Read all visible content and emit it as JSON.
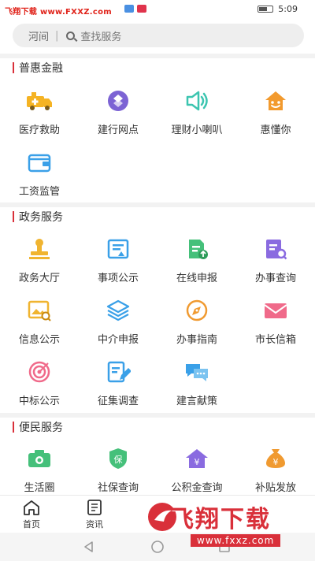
{
  "status_bar": {
    "watermark": "飞翔下载 www.FXXZ.com",
    "time": "5:09"
  },
  "search": {
    "location": "河间",
    "separator": "|",
    "placeholder": "查找服务"
  },
  "sections": [
    {
      "title": "普惠金融",
      "items": [
        {
          "label": "医疗救助",
          "icon": "ambulance-icon",
          "color": "#f5b323"
        },
        {
          "label": "建行网点",
          "icon": "bank-logo-icon",
          "color": "#7c63d4"
        },
        {
          "label": "理财小喇叭",
          "icon": "speaker-icon",
          "color": "#3cc5b0"
        },
        {
          "label": "惠懂你",
          "icon": "smiley-house-icon",
          "color": "#f29a2e"
        },
        {
          "label": "工资监管",
          "icon": "wallet-icon",
          "color": "#3aa0e8"
        }
      ]
    },
    {
      "title": "政务服务",
      "items": [
        {
          "label": "政务大厅",
          "icon": "stamp-icon",
          "color": "#f0b430"
        },
        {
          "label": "事项公示",
          "icon": "notice-board-icon",
          "color": "#3aa0e8"
        },
        {
          "label": "在线申报",
          "icon": "upload-doc-icon",
          "color": "#45c07a"
        },
        {
          "label": "办事查询",
          "icon": "doc-search-icon",
          "color": "#8a6be0"
        },
        {
          "label": "信息公示",
          "icon": "image-search-icon",
          "color": "#f0b430"
        },
        {
          "label": "中介申报",
          "icon": "layers-icon",
          "color": "#3aa0e8"
        },
        {
          "label": "办事指南",
          "icon": "compass-icon",
          "color": "#f09a30"
        },
        {
          "label": "市长信箱",
          "icon": "mail-icon",
          "color": "#f06a8a"
        },
        {
          "label": "中标公示",
          "icon": "target-icon",
          "color": "#f06a8a"
        },
        {
          "label": "征集调查",
          "icon": "edit-doc-icon",
          "color": "#3aa0e8"
        },
        {
          "label": "建言献策",
          "icon": "chat-bubbles-icon",
          "color": "#3aa0e8"
        }
      ]
    },
    {
      "title": "便民服务",
      "items": [
        {
          "label": "生活圈",
          "icon": "camera-icon",
          "color": "#45c07a"
        },
        {
          "label": "社保查询",
          "icon": "shield-icon",
          "color": "#45c07a",
          "glyph": "保"
        },
        {
          "label": "公积金查询",
          "icon": "house-yen-icon",
          "color": "#8a6be0",
          "glyph": "¥"
        },
        {
          "label": "补贴发放",
          "icon": "money-bag-icon",
          "color": "#f09a30",
          "glyph": "¥"
        }
      ]
    }
  ],
  "tabbar": [
    {
      "label": "首页",
      "icon": "home-icon"
    },
    {
      "label": "资讯",
      "icon": "news-icon"
    }
  ],
  "watermark_logo": {
    "title": "飞翔下载",
    "url": "www.fxxz.com"
  }
}
